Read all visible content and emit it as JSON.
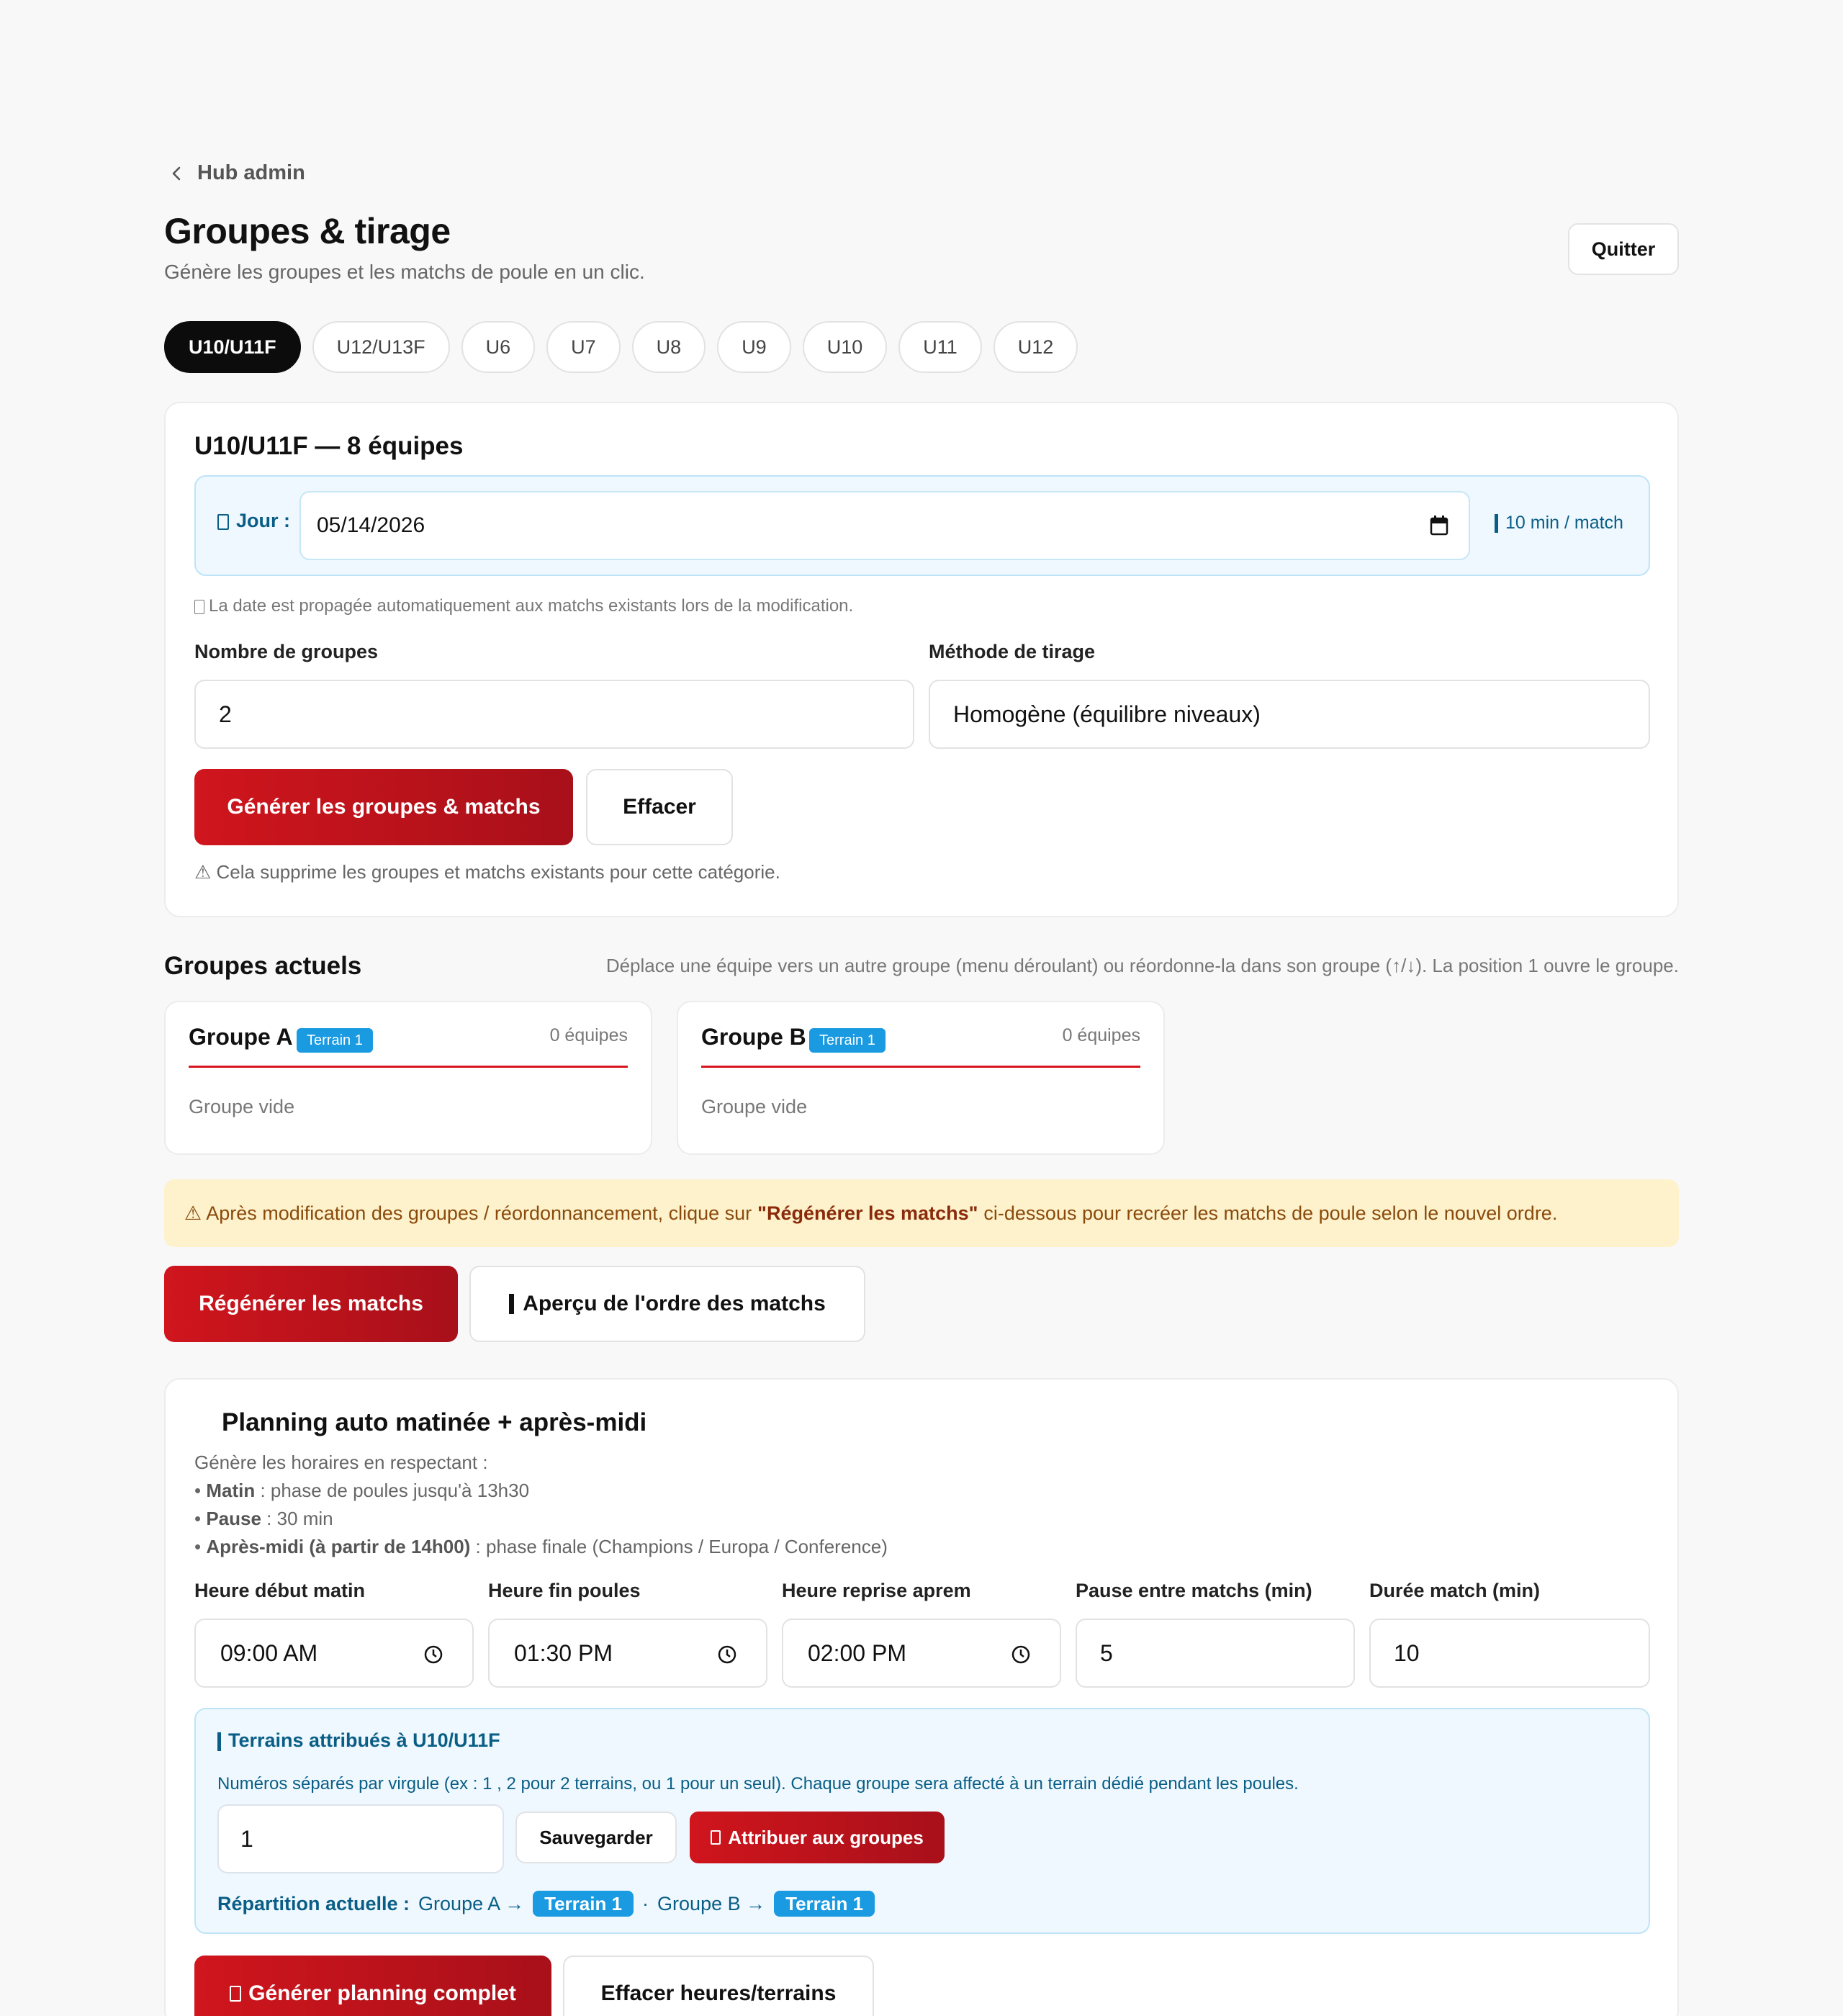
{
  "nav": {
    "back_label": "Hub admin"
  },
  "header": {
    "title": "Groupes & tirage",
    "subtitle": "Génère les groupes et les matchs de poule en un clic.",
    "quit_label": "Quitter"
  },
  "tabs": [
    {
      "label": "U10/U11F",
      "active": true
    },
    {
      "label": "U12/U13F"
    },
    {
      "label": "U6"
    },
    {
      "label": "U7"
    },
    {
      "label": "U8"
    },
    {
      "label": "U9"
    },
    {
      "label": "U10"
    },
    {
      "label": "U11"
    },
    {
      "label": "U12"
    }
  ],
  "config": {
    "title": "U10/U11F — 8 équipes",
    "day_label": "Jour :",
    "date_value": "05/14/2026",
    "per_match": "10 min / match",
    "date_note": "La date est propagée automatiquement aux matchs existants lors de la modification.",
    "groups_label": "Nombre de groupes",
    "groups_value": "2",
    "method_label": "Méthode de tirage",
    "method_value": "Homogène (équilibre niveaux)",
    "generate_label": "Générer les groupes & matchs",
    "clear_label": "Effacer",
    "warning": "⚠ Cela supprime les groupes et matchs existants pour cette catégorie."
  },
  "groups_section": {
    "title": "Groupes actuels",
    "hint": "Déplace une équipe vers un autre groupe (menu déroulant) ou réordonne-la dans son groupe (↑/↓). La position 1 ouvre le groupe.",
    "groups": [
      {
        "name": "Groupe A",
        "badge": "Terrain 1",
        "count": "0 équipes",
        "empty": "Groupe vide"
      },
      {
        "name": "Groupe B",
        "badge": "Terrain 1",
        "count": "0 équipes",
        "empty": "Groupe vide"
      }
    ]
  },
  "regen": {
    "warn_pre": "⚠ Après modification des groupes / réordonnancement, clique sur",
    "warn_strong": "\"Régénérer les matchs\"",
    "warn_post": "ci-dessous pour recréer les matchs de poule selon le nouvel ordre.",
    "regen_label": "Régénérer les matchs",
    "preview_label": "Aperçu de l'ordre des matchs"
  },
  "planning": {
    "title": "Planning auto matinée + après-midi",
    "intro": "Génère les horaires en respectant :",
    "l1_b": "Matin",
    "l1": " : phase de poules jusqu'à 13h30",
    "l2_b": "Pause",
    "l2": " : 30 min",
    "l3_b": "Après-midi (à partir de 14h00)",
    "l3": " : phase finale (Champions / Europa / Conference)",
    "fields": [
      {
        "label": "Heure début matin",
        "value": "09:00 AM",
        "time": true
      },
      {
        "label": "Heure fin poules",
        "value": "01:30 PM",
        "time": true
      },
      {
        "label": "Heure reprise aprem",
        "value": "02:00 PM",
        "time": true
      },
      {
        "label": "Pause entre matchs (min)",
        "value": "5"
      },
      {
        "label": "Durée match (min)",
        "value": "10"
      }
    ],
    "terrains_title": "Terrains attribués à U10/U11F",
    "terrains_desc": "Numéros séparés par virgule (ex : 1 , 2 pour 2 terrains, ou 1 pour un seul). Chaque groupe sera affecté à un terrain dédié pendant les poules.",
    "terrains_value": "1",
    "save_label": "Sauvegarder",
    "assign_label": "Attribuer aux groupes",
    "rep_label": "Répartition actuelle :",
    "rep_a": "Groupe A →",
    "rep_a_badge": "Terrain 1",
    "rep_sep": "·",
    "rep_b": "Groupe B →",
    "rep_b_badge": "Terrain 1",
    "gen_label": "Générer planning complet",
    "clear_label": "Effacer heures/terrains"
  }
}
